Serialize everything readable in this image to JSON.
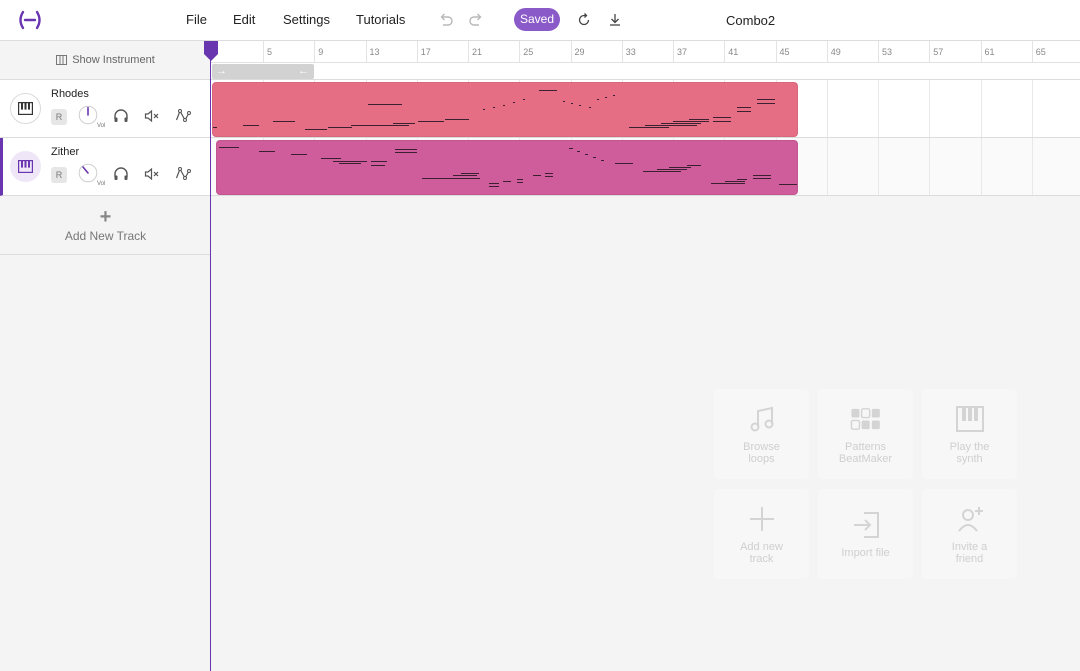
{
  "app": {
    "project_title": "Combo2",
    "accent_color": "#6a36b0"
  },
  "menu": {
    "file": "File",
    "edit": "Edit",
    "settings": "Settings",
    "tutorials": "Tutorials"
  },
  "toolbar": {
    "saved_label": "Saved",
    "icons": [
      "undo-icon",
      "redo-icon",
      "refresh-icon",
      "download-icon"
    ]
  },
  "left_panel": {
    "show_instrument": "Show Instrument",
    "add_track": "Add New Track"
  },
  "tracks": [
    {
      "name": "Rhodes",
      "record_label": "R",
      "vol_label": "Vol",
      "volume": 0.5,
      "color": "#e56e85",
      "selected": false
    },
    {
      "name": "Zither",
      "record_label": "R",
      "vol_label": "Vol",
      "volume": 0.2,
      "color": "#cf5c9b",
      "selected": true
    }
  ],
  "ruler": {
    "ticks": [
      "5",
      "9",
      "13",
      "17",
      "21",
      "25",
      "29",
      "33",
      "37",
      "41",
      "45",
      "49",
      "53",
      "57",
      "61",
      "65"
    ]
  },
  "quick_actions": [
    {
      "label": "Browse\nloops",
      "icon": "music-note-icon"
    },
    {
      "label": "Patterns\nBeatMaker",
      "icon": "pads-grid-icon"
    },
    {
      "label": "Play the\nsynth",
      "icon": "piano-keys-icon"
    },
    {
      "label": "Add new\ntrack",
      "icon": "plus-icon"
    },
    {
      "label": "Import file",
      "icon": "import-icon"
    },
    {
      "label": "Invite a\nfriend",
      "icon": "add-user-icon"
    }
  ]
}
